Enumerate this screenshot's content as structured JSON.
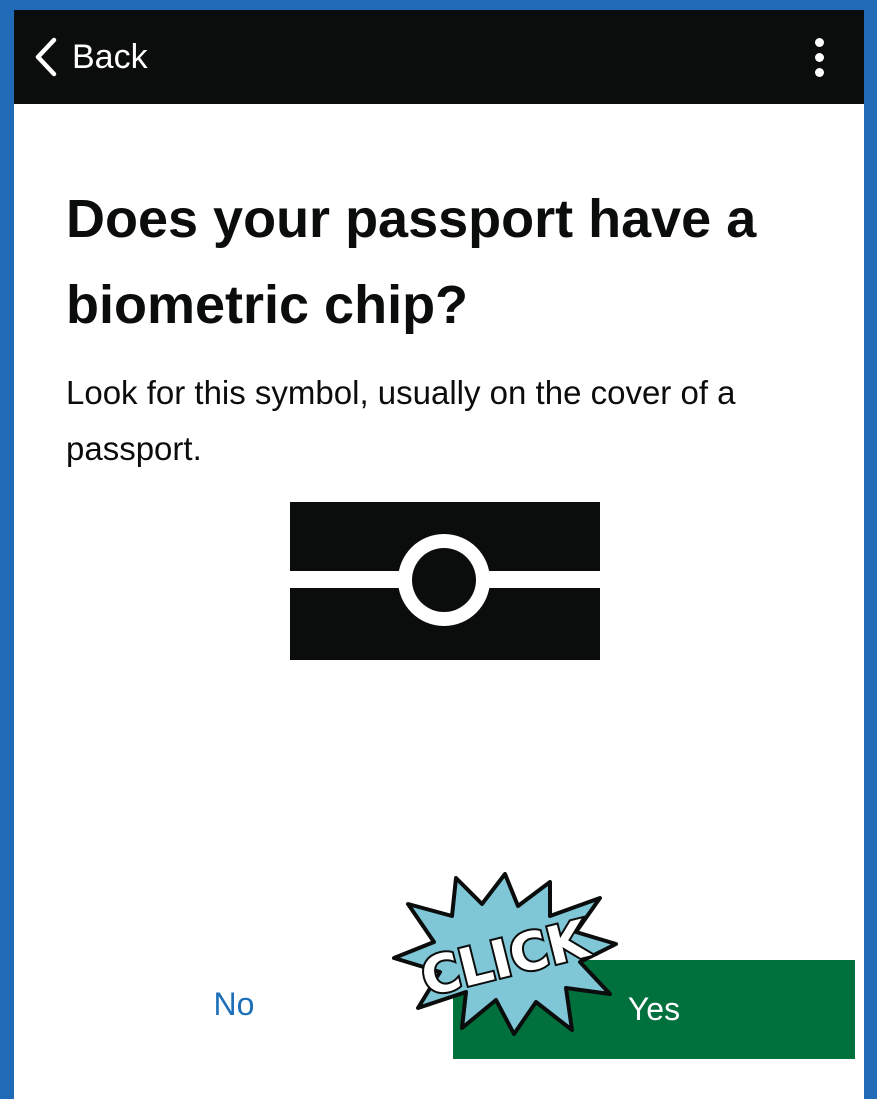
{
  "header": {
    "back_label": "Back",
    "back_icon": "chevron-left-icon",
    "menu_icon": "more-vertical-icon"
  },
  "content": {
    "title": "Does your passport have a biometric chip?",
    "description": "Look for this symbol, usually on the cover of a passport.",
    "symbol_icon": "biometric-chip-icon"
  },
  "actions": {
    "no_label": "No",
    "yes_label": "Yes"
  },
  "overlay": {
    "sticker_text": "CLICK"
  },
  "colors": {
    "frame": "#1f6bb8",
    "topbar": "#0b0c0c",
    "yes_button": "#00703c",
    "no_link": "#1d70b8",
    "sticker": "#7fc6d6"
  }
}
